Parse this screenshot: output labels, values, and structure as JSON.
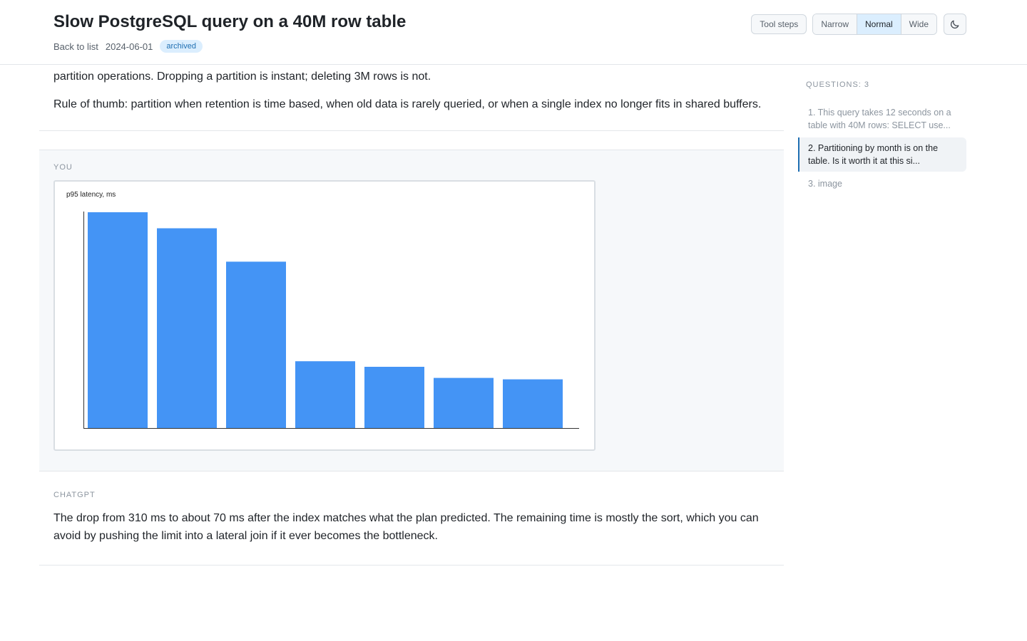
{
  "header": {
    "title": "Slow PostgreSQL query on a 40M row table",
    "back_label": "Back to list",
    "date": "2024-06-01",
    "badge": "archived",
    "tool_steps_label": "Tool steps",
    "width_options": [
      "Narrow",
      "Normal",
      "Wide"
    ],
    "width_selected": "Normal",
    "theme_icon": "moon-icon"
  },
  "conversation": {
    "top_message": {
      "paragraphs": [
        "partition operations. Dropping a partition is instant; deleting 3M rows is not.",
        "Rule of thumb: partition when retention is time based, when old data is rarely queried, or when a single index no longer fits in shared buffers."
      ]
    },
    "user_message": {
      "role": "You",
      "attachment": "chart-image"
    },
    "assistant_message": {
      "role": "ChatGPT",
      "text": "The drop from 310 ms to about 70 ms after the index matches what the plan predicted. The remaining time is mostly the sort, which you can avoid by pushing the limit into a lateral join if it ever becomes the bottleneck."
    }
  },
  "sidebar": {
    "title": "Questions: 3",
    "items": [
      {
        "label": "1. This query takes 12 seconds on a table with 40M rows: SELECT use...",
        "active": false
      },
      {
        "label": "2. Partitioning by month is on the table. Is it worth it at this si...",
        "active": true
      },
      {
        "label": "3. image",
        "active": false
      }
    ]
  },
  "chart_data": {
    "type": "bar",
    "title": "p95 latency, ms",
    "categories": [
      "",
      "",
      "",
      "",
      "",
      "",
      ""
    ],
    "values": [
      310,
      287,
      239,
      96,
      88,
      72,
      70
    ],
    "ylim": [
      0,
      310
    ],
    "bar_color": "#4494f5",
    "grid": false,
    "xlabel": "",
    "ylabel": ""
  }
}
